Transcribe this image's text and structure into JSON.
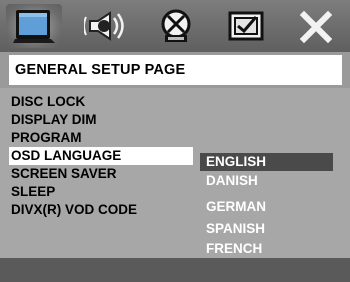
{
  "tabs": [
    {
      "icon": "general-setup-icon",
      "active": true
    },
    {
      "icon": "audio-setup-icon",
      "active": false
    },
    {
      "icon": "video-setup-icon",
      "active": false
    },
    {
      "icon": "preference-setup-icon",
      "active": false
    },
    {
      "icon": "exit-icon",
      "active": false
    }
  ],
  "page_title": "GENERAL SETUP PAGE",
  "menu_items": [
    {
      "label": "DISC LOCK"
    },
    {
      "label": "DISPLAY DIM"
    },
    {
      "label": "PROGRAM"
    },
    {
      "label": "OSD LANGUAGE",
      "selected": true
    },
    {
      "label": "SCREEN SAVER"
    },
    {
      "label": "SLEEP"
    },
    {
      "label": "DIVX(R) VOD CODE"
    }
  ],
  "language_options": [
    {
      "label": "ENGLISH",
      "selected": true
    },
    {
      "label": "DANISH"
    },
    {
      "label": "GERMAN"
    },
    {
      "label": "SPANISH"
    },
    {
      "label": "FRENCH"
    }
  ],
  "colors": {
    "background": "#a7a7a7",
    "icon_bar": "#6b6b6b",
    "highlight_menu": "#ffffff",
    "highlight_option": "#4a4a4a",
    "option_text": "#ffffff"
  }
}
